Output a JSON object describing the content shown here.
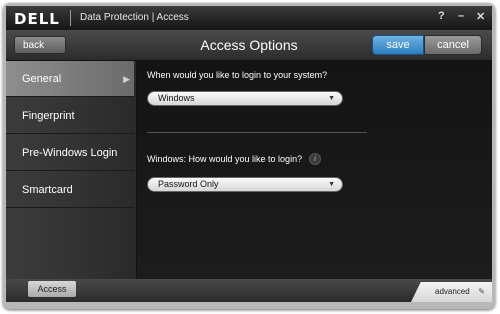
{
  "window": {
    "brand": "DELL",
    "title": "Data Protection | Access",
    "controls": {
      "help": "?",
      "minimize": "–",
      "close": "✕"
    }
  },
  "header": {
    "back_label": "back",
    "page_title": "Access Options",
    "save_label": "save",
    "cancel_label": "cancel"
  },
  "sidebar": {
    "items": [
      {
        "label": "General",
        "active": true
      },
      {
        "label": "Fingerprint",
        "active": false
      },
      {
        "label": "Pre-Windows Login",
        "active": false
      },
      {
        "label": "Smartcard",
        "active": false
      }
    ],
    "active_arrow": "▶"
  },
  "main": {
    "q1": "When would you like to login to your system?",
    "q1_value": "Windows",
    "q2": "Windows:  How would you like to login?",
    "q2_info": "i",
    "q2_value": "Password Only",
    "dropdown_arrow": "▼"
  },
  "footer": {
    "tab_label": "Access",
    "advanced_label": "advanced",
    "advanced_icon": "✎"
  },
  "colors": {
    "accent": "#2c7dbf",
    "panel_dark": "#1a1a1a",
    "sidebar_active": "#7c7c7c"
  }
}
